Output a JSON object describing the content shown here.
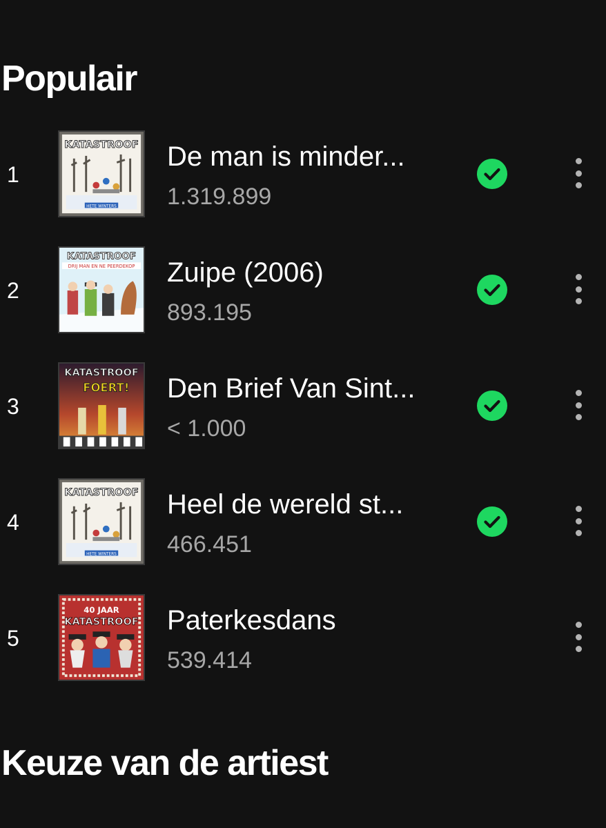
{
  "sections": {
    "popular_title": "Populair",
    "artist_pick_title": "Keuze van de artiest"
  },
  "colors": {
    "background": "#121212",
    "primary_text": "#ffffff",
    "secondary_text": "#a7a7a7",
    "saved_accent": "#1ed760"
  },
  "tracks": [
    {
      "rank": "1",
      "name": "De man is minder...",
      "plays": "1.319.899",
      "saved": true,
      "cover": "hete-winters-cover"
    },
    {
      "rank": "2",
      "name": "Zuipe (2006)",
      "plays": "893.195",
      "saved": true,
      "cover": "drij-man-en-ne-peerdekop-cover"
    },
    {
      "rank": "3",
      "name": "Den Brief Van Sint...",
      "plays": "< 1.000",
      "saved": true,
      "cover": "foert-cover"
    },
    {
      "rank": "4",
      "name": "Heel de wereld st...",
      "plays": "466.451",
      "saved": true,
      "cover": "hete-winters-cover"
    },
    {
      "rank": "5",
      "name": "Paterkesdans",
      "plays": "539.414",
      "saved": false,
      "cover": "40-jaar-katastroof-cover"
    }
  ],
  "covers": {
    "hete-winters-cover": {
      "logo": "KATASTROOF",
      "caption": "HETE WINTERS"
    },
    "drij-man-en-ne-peerdekop-cover": {
      "logo": "KATASTROOF",
      "caption": "DRIJ MAN EN NE PEERDEKOP"
    },
    "foert-cover": {
      "logo": "KATASTROOF",
      "caption": "FOERT!"
    },
    "40-jaar-katastroof-cover": {
      "logo": "KATASTROOF",
      "caption": "40 JAAR"
    }
  },
  "icons": {
    "saved": "check-circle-icon",
    "more": "more-vertical-icon"
  }
}
